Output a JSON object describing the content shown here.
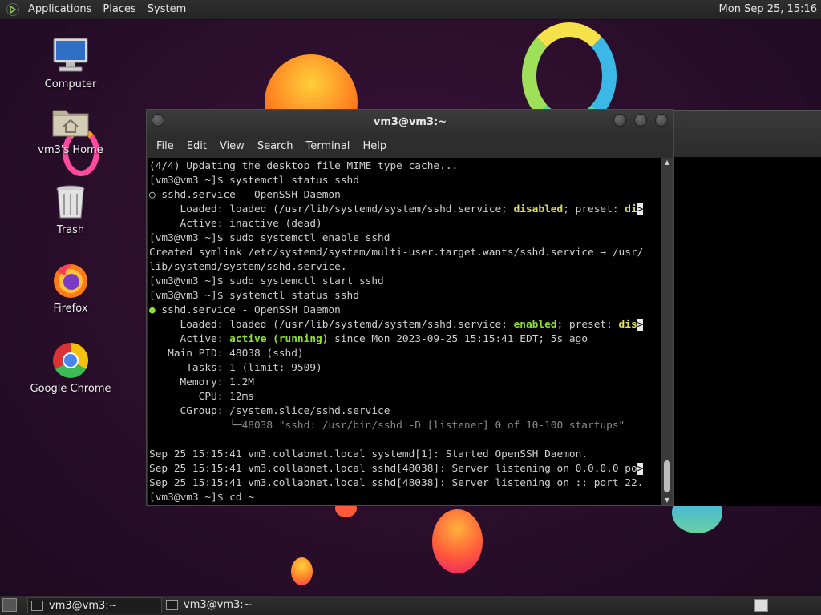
{
  "top_panel": {
    "menus": [
      "Applications",
      "Places",
      "System"
    ],
    "clock": "Mon Sep 25, 15:16"
  },
  "desktop_icons": [
    {
      "label": "Computer",
      "icon": "computer-icon"
    },
    {
      "label": "vm3's Home",
      "icon": "home-folder-icon"
    },
    {
      "label": "Trash",
      "icon": "trash-icon"
    },
    {
      "label": "Firefox",
      "icon": "firefox-icon"
    },
    {
      "label": "Google Chrome",
      "icon": "chrome-icon"
    }
  ],
  "terminal": {
    "title": "vm3@vm3:~",
    "menu": [
      "File",
      "Edit",
      "View",
      "Search",
      "Terminal",
      "Help"
    ],
    "lines": {
      "l1": "(4/4) Updating the desktop file MIME type cache...",
      "l2": "[vm3@vm3 ~]$ systemctl status sshd",
      "l3": "○ sshd.service - OpenSSH Daemon",
      "l4a": "     Loaded: loaded (/usr/lib/systemd/system/sshd.service; ",
      "l4b": "disabled",
      "l4c": "; preset: ",
      "l4d": "di",
      "l5": "     Active: inactive (dead)",
      "l6": "[vm3@vm3 ~]$ sudo systemctl enable sshd",
      "l7": "Created symlink /etc/systemd/system/multi-user.target.wants/sshd.service → /usr/",
      "l8": "lib/systemd/system/sshd.service.",
      "l9": "[vm3@vm3 ~]$ sudo systemctl start sshd",
      "l10": "[vm3@vm3 ~]$ systemctl status sshd",
      "l11a": "●",
      "l11b": " sshd.service - OpenSSH Daemon",
      "l12a": "     Loaded: loaded (/usr/lib/systemd/system/sshd.service; ",
      "l12b": "enabled",
      "l12c": "; preset: ",
      "l12d": "dis",
      "l13a": "     Active: ",
      "l13b": "active (running)",
      "l13c": " since Mon 2023-09-25 15:15:41 EDT; 5s ago",
      "l14": "   Main PID: 48038 (sshd)",
      "l15": "      Tasks: 1 (limit: 9509)",
      "l16": "     Memory: 1.2M",
      "l17": "        CPU: 12ms",
      "l18": "     CGroup: /system.slice/sshd.service",
      "l19": "             └─48038 \"sshd: /usr/bin/sshd -D [listener] 0 of 10-100 startups\"",
      "l20": "",
      "l21": "Sep 25 15:15:41 vm3.collabnet.local systemd[1]: Started OpenSSH Daemon.",
      "l22a": "Sep 25 15:15:41 vm3.collabnet.local sshd[48038]: Server listening on 0.0.0.0 po",
      "l23": "Sep 25 15:15:41 vm3.collabnet.local sshd[48038]: Server listening on :: port 22.",
      "l24": "[vm3@vm3 ~]$ cd ~"
    },
    "overflow_marker": ">"
  },
  "taskbar": {
    "tasks": [
      "vm3@vm3:~",
      "vm3@vm3:~"
    ]
  }
}
